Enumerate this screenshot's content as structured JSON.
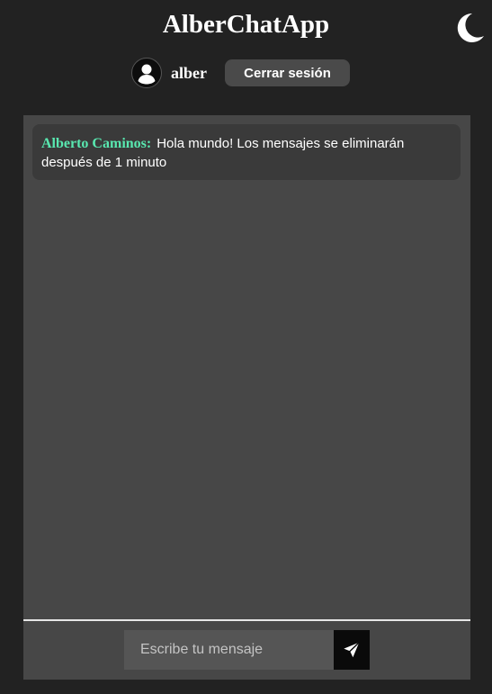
{
  "header": {
    "title": "AlberChatApp",
    "theme_icon": "moon-icon"
  },
  "user": {
    "avatar_icon": "user-avatar-icon",
    "name": "alber",
    "logout_label": "Cerrar sesión"
  },
  "chat": {
    "messages": [
      {
        "author": "Alberto Caminos:",
        "text": "Hola mundo! Los mensajes se eliminarán después de 1 minuto"
      }
    ]
  },
  "composer": {
    "placeholder": "Escribe tu mensaje",
    "value": "",
    "send_icon": "send-icon"
  },
  "colors": {
    "background": "#222222",
    "panel": "#474747",
    "message_bubble": "#3a3a3a",
    "author": "#59e8b0",
    "button": "#4a4a4a",
    "send_button": "#0a0a0a"
  }
}
